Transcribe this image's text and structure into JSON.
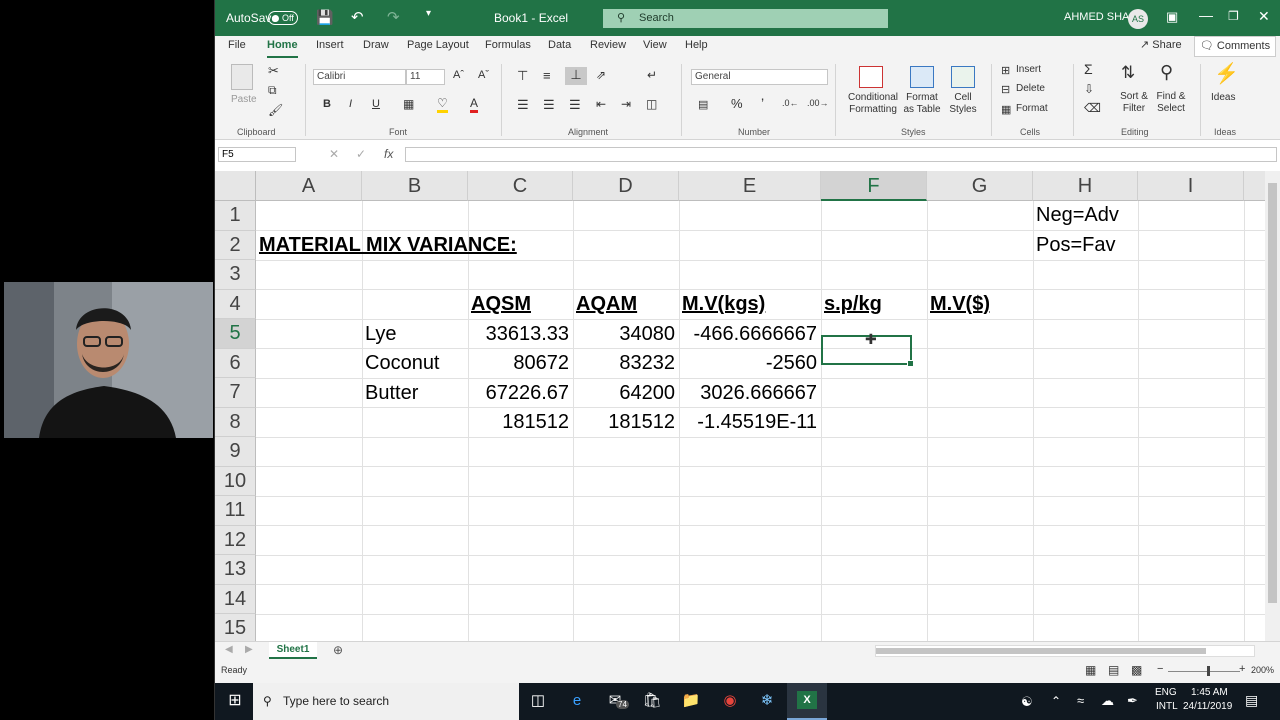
{
  "titlebar": {
    "autosave_label": "AutoSave",
    "autosave_state": "Off",
    "doc_title": "Book1  -  Excel",
    "search_placeholder": "Search",
    "user_name": "AHMED SHAFI",
    "user_initials": "AS"
  },
  "menu": {
    "tabs": [
      "File",
      "Home",
      "Insert",
      "Draw",
      "Page Layout",
      "Formulas",
      "Data",
      "Review",
      "View",
      "Help"
    ],
    "share": "Share",
    "comments": "Comments"
  },
  "ribbon": {
    "clipboard": {
      "paste": "Paste",
      "label": "Clipboard"
    },
    "font": {
      "name": "Calibri",
      "size": "11",
      "label": "Font"
    },
    "alignment": {
      "label": "Alignment"
    },
    "number": {
      "format": "General",
      "label": "Number"
    },
    "styles": {
      "conditional_formatting": "Conditional Formatting",
      "format_as_table": "Format as Table",
      "cell_styles": "Cell Styles",
      "label": "Styles"
    },
    "cells": {
      "insert": "Insert",
      "delete": "Delete",
      "format": "Format",
      "label": "Cells"
    },
    "editing": {
      "sort_filter": "Sort & Filter",
      "find_select": "Find & Select",
      "label": "Editing"
    },
    "ideas": {
      "ideas": "Ideas",
      "label": "Ideas"
    }
  },
  "formula_bar": {
    "name_box": "F5",
    "fx": "fx",
    "value": ""
  },
  "sheet": {
    "columns": [
      "A",
      "B",
      "C",
      "D",
      "E",
      "F",
      "G",
      "H",
      "I"
    ],
    "rows": [
      "1",
      "2",
      "3",
      "4",
      "5",
      "6",
      "7",
      "8",
      "9",
      "10",
      "11",
      "12",
      "13",
      "14",
      "15"
    ],
    "selected_column": "F",
    "selected_row": "5",
    "cells": {
      "H1": "Neg=Adv",
      "H2": "Pos=Fav",
      "A2": "MATERIAL MIX VARIANCE:",
      "C4": "AQSM",
      "D4": "AQAM",
      "E4": "M.V(kgs)",
      "F4": "s.p/kg",
      "G4": "M.V($)",
      "B5": "Lye",
      "C5": "33613.33",
      "D5": "34080",
      "E5": "-466.6666667",
      "B6": "Coconut",
      "C6": "80672",
      "D6": "83232",
      "E6": "-2560",
      "B7": "Butter",
      "C7": "67226.67",
      "D7": "64200",
      "E7": "3026.666667",
      "C8": "181512",
      "D8": "181512",
      "E8": "-1.45519E-11"
    }
  },
  "sheet_tabs": {
    "active": "Sheet1"
  },
  "status": {
    "ready": "Ready",
    "zoom": "200%"
  },
  "taskbar": {
    "search_placeholder": "Type here to search",
    "mail_badge": "74",
    "lang": "ENG",
    "lang_sub": "INTL",
    "time": "1:45 AM",
    "date": "24/11/2019"
  },
  "colors": {
    "excel_green": "#217346",
    "taskbar": "#101820"
  }
}
